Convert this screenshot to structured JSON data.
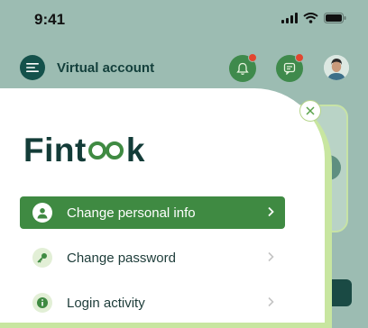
{
  "status_bar": {
    "time": "9:41"
  },
  "header": {
    "title": "Virtual account"
  },
  "drawer": {
    "brand": {
      "part1": "Fint",
      "part2": "k"
    },
    "items": [
      {
        "label": "Change personal info",
        "icon": "user-icon",
        "active": true
      },
      {
        "label": "Change password",
        "icon": "key-icon",
        "active": false
      },
      {
        "label": "Login activity",
        "icon": "info-icon",
        "active": false
      }
    ]
  },
  "colors": {
    "accent": "#3f8a42",
    "brand_dark": "#133c38",
    "notification": "#e2462f",
    "background": "#9cbcb2",
    "drawer_edge": "#c8e6a0"
  }
}
